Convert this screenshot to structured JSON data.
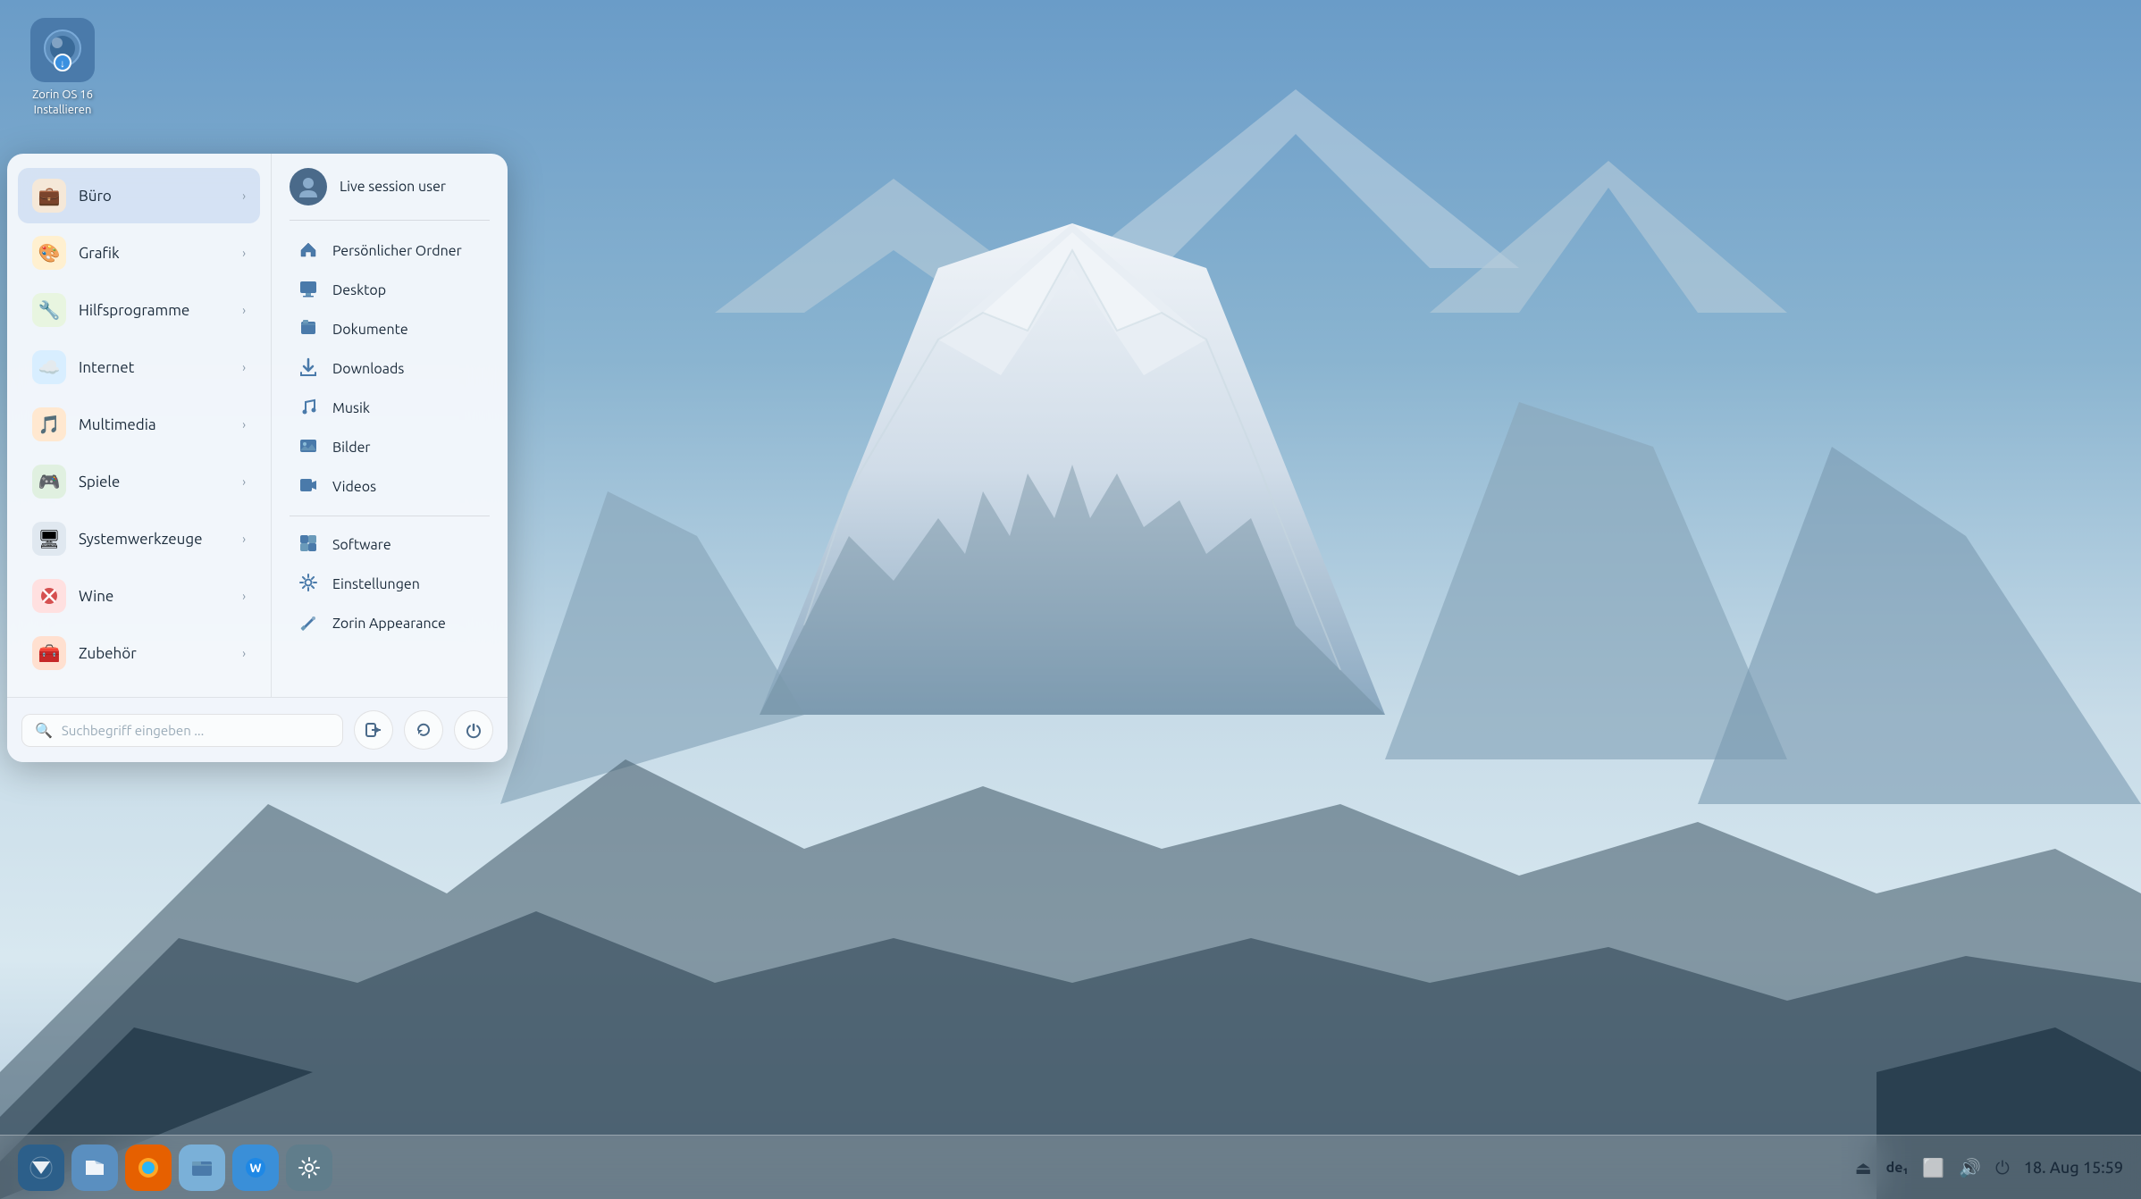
{
  "desktop": {
    "bg_colors": [
      "#5a7fa8",
      "#3a6494",
      "#c8d8e8",
      "#e8ecf0"
    ],
    "icon": {
      "label_line1": "Zorin OS 16",
      "label_line2": "Installieren"
    }
  },
  "menu": {
    "categories": [
      {
        "id": "buero",
        "label": "Büro",
        "icon": "💼",
        "color": "#b87a40",
        "active": true
      },
      {
        "id": "grafik",
        "label": "Grafik",
        "icon": "🎨",
        "color": "#e0a030"
      },
      {
        "id": "hilfsprogramme",
        "label": "Hilfsprogramme",
        "icon": "🔧",
        "color": "#50a040"
      },
      {
        "id": "internet",
        "label": "Internet",
        "icon": "☁️",
        "color": "#4090e0"
      },
      {
        "id": "multimedia",
        "label": "Multimedia",
        "icon": "🎵",
        "color": "#e06020"
      },
      {
        "id": "spiele",
        "label": "Spiele",
        "icon": "🎮",
        "color": "#50a050"
      },
      {
        "id": "systemwerkzeuge",
        "label": "Systemwerkzeuge",
        "icon": "🖥",
        "color": "#606060"
      },
      {
        "id": "wine",
        "label": "Wine",
        "icon": "❌",
        "color": "#c03030"
      },
      {
        "id": "zubehoer",
        "label": "Zubehör",
        "icon": "🧰",
        "color": "#c03030"
      }
    ],
    "user": {
      "name": "Live session user",
      "avatar_icon": "👤"
    },
    "folders": [
      {
        "id": "home",
        "label": "Persönlicher Ordner",
        "icon": "🏠"
      },
      {
        "id": "desktop",
        "label": "Desktop",
        "icon": "🖥"
      },
      {
        "id": "documents",
        "label": "Dokumente",
        "icon": "📁"
      },
      {
        "id": "downloads",
        "label": "Downloads",
        "icon": "⬇"
      },
      {
        "id": "music",
        "label": "Musik",
        "icon": "🎵"
      },
      {
        "id": "pictures",
        "label": "Bilder",
        "icon": "🖼"
      },
      {
        "id": "videos",
        "label": "Videos",
        "icon": "🎬"
      }
    ],
    "system_items": [
      {
        "id": "software",
        "label": "Software",
        "icon": "📦"
      },
      {
        "id": "settings",
        "label": "Einstellungen",
        "icon": "⚙"
      },
      {
        "id": "appearance",
        "label": "Zorin Appearance",
        "icon": "✏"
      }
    ],
    "search": {
      "placeholder": "Suchbegriff eingeben ..."
    },
    "bottom_buttons": [
      {
        "id": "logout",
        "icon": "⏏",
        "tooltip": "Abmelden"
      },
      {
        "id": "restart",
        "icon": "↺",
        "tooltip": "Neustart"
      },
      {
        "id": "power",
        "icon": "⏻",
        "tooltip": "Ausschalten"
      }
    ]
  },
  "taskbar": {
    "apps": [
      {
        "id": "zorin-menu",
        "icon": "Z",
        "type": "zorin",
        "label": "Zorin Menu"
      },
      {
        "id": "files",
        "icon": "📁",
        "type": "files",
        "label": "Dateien"
      },
      {
        "id": "firefox",
        "icon": "🦊",
        "type": "firefox",
        "label": "Firefox"
      },
      {
        "id": "file-manager",
        "icon": "🗂",
        "type": "fileman",
        "label": "Dateimanager"
      },
      {
        "id": "software-center",
        "icon": "🌐",
        "type": "software",
        "label": "Software"
      },
      {
        "id": "settings-app",
        "icon": "⚙",
        "type": "settings",
        "label": "Einstellungen"
      }
    ],
    "system": {
      "eject_icon": "⏏",
      "lang": "de₁",
      "window_icon": "⬜",
      "volume_icon": "🔊",
      "power_icon": "⏻",
      "datetime": "18. Aug  15:59"
    }
  }
}
